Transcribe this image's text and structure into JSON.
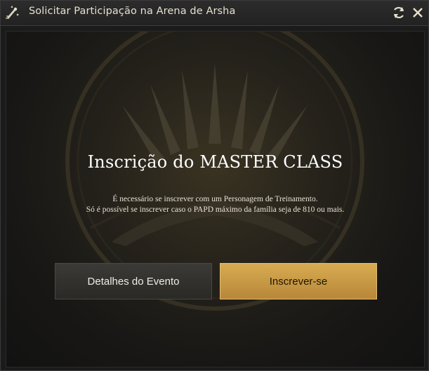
{
  "window": {
    "title": "Solicitar Participação na Arena de Arsha",
    "icons": {
      "app": "trophy-icon",
      "refresh": "refresh-icon",
      "close": "close-icon"
    }
  },
  "main": {
    "heading": "Inscrição do MASTER CLASS",
    "description_lines": [
      "É necessário se inscrever com um Personagem de Treinamento.",
      "Só é possível se inscrever caso o PAPD máximo da família seja de 810 ou mais."
    ],
    "buttons": {
      "details_label": "Detalhes do Evento",
      "signup_label": "Inscrever-se"
    }
  },
  "colors": {
    "accent": "#c99a45",
    "title_text": "#e6e0cf",
    "button_dark": "#33322f"
  }
}
